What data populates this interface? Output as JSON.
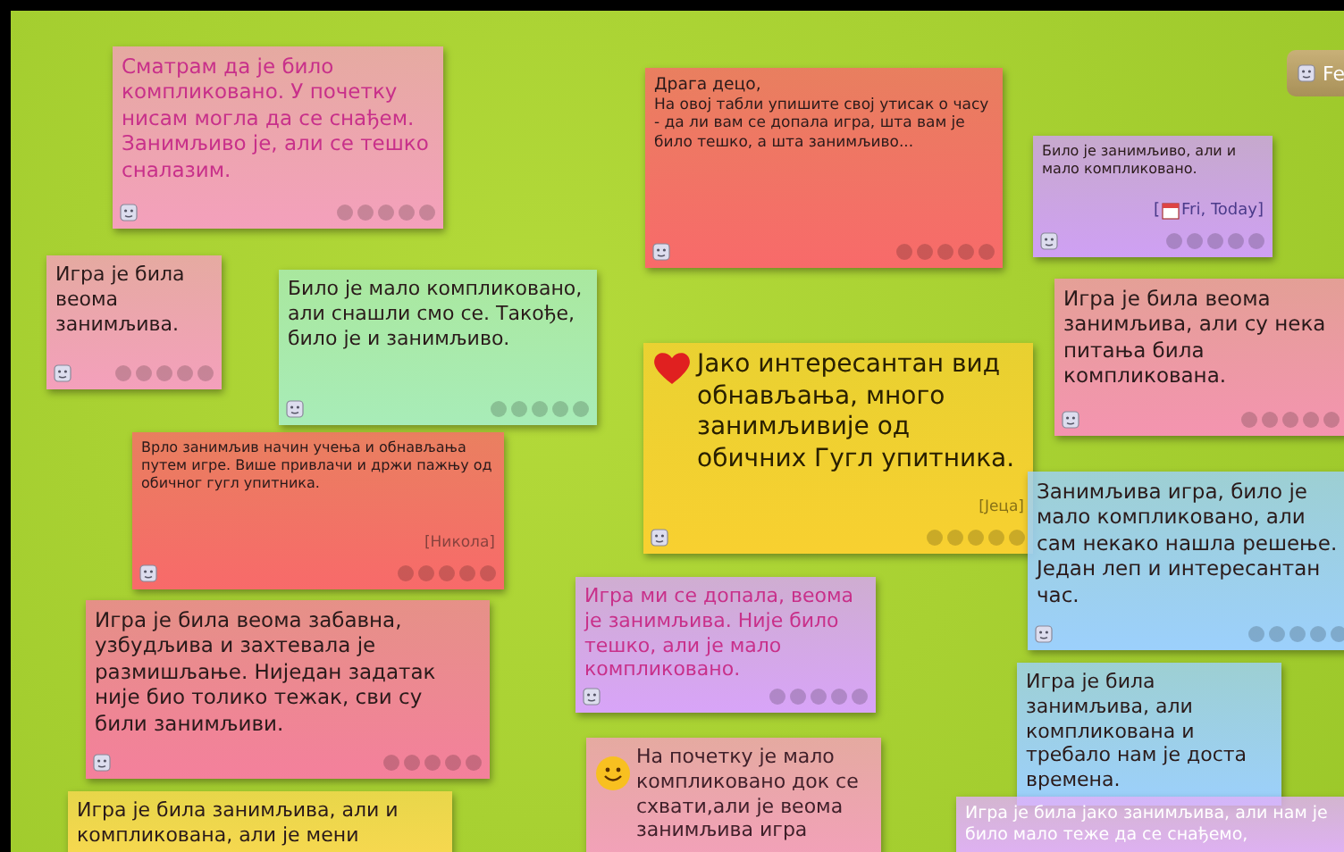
{
  "board_button": {
    "label": "Fe"
  },
  "notes": [
    {
      "kind": "accent",
      "color": "#f4a0bc",
      "text": "Сматрам да је било компликовано. У почетку нисам могла да се снађем. Занимљиво је, али се тешко сналазим.",
      "footer": true
    },
    {
      "kind": "plain",
      "color": "#f86a6a",
      "title": "Драга децо,",
      "text": "На овој табли упишите свој утисак о часу - да ли вам се допала игра, шта вам је било тешко, а шта занимљиво...",
      "footer": true
    },
    {
      "kind": "plain",
      "color": "#cfa0f4",
      "text": "Било је занимљиво, али и мало компликовано.",
      "date_prefix": "[",
      "date": "Fri, Today]",
      "footer": true
    },
    {
      "kind": "plain",
      "color": "#f4a0bc",
      "text": "Игра је била веома занимљива.",
      "footer": true
    },
    {
      "kind": "plain",
      "color": "#a8ecb8",
      "text": "Било је мало компликовано, али снашли смо се. Такође, било је и занимљиво.",
      "footer": true
    },
    {
      "kind": "plain",
      "color": "#f494b0",
      "text": "Игра је била веома занимљива, али су нека питања била компликована.",
      "footer": true
    },
    {
      "kind": "heart",
      "color": "#f8d030",
      "text": "Јако интересантан вид обнављања, много занимљивије од обичних Гугл упитника.",
      "signature": "[Јеца]",
      "footer": true
    },
    {
      "kind": "plain",
      "color": "#f86a6a",
      "text": "Врло занимљив начин учења и обнављања путем игре. Више привлачи и држи пажњу од обичног гугл упитника.",
      "signature": "[Никола]",
      "footer": true
    },
    {
      "kind": "plain",
      "color": "#f4809c",
      "text": "Игра је била веома забавна, узбудљива и захтевала је размишљање. Ниједан задатак није био толико тежак, сви су били занимљиви.",
      "footer": true
    },
    {
      "kind": "accent",
      "color": "#d8a4f8",
      "text": "Игра ми се допала, веома је занимљива. Није било тешко, али је мало компликовано.",
      "footer": true
    },
    {
      "kind": "plain",
      "color": "#9cd0fc",
      "text": "Занимљива игра, било је мало компликовано, али сам некако нашла решење. Један леп и интересантан час.",
      "footer": true
    },
    {
      "kind": "plain",
      "color": "#9cd0fc",
      "text": "Игра је била занимљива, али компликована и требало нам је доста времена.",
      "footer": false
    },
    {
      "kind": "plain",
      "color": "#f8d850",
      "text": "Игра је била занимљива, али и компликована, али је мени",
      "footer": false
    },
    {
      "kind": "smiley",
      "color": "#f4a0bc",
      "text": "На почетку је мало компликовано док се схвати,али је веома занимљива игра",
      "footer": false
    },
    {
      "kind": "inverse",
      "color": "#e0b0f8",
      "text": "Игра је била јако занимљива, али нам је било мало теже да се снађемо,",
      "footer": false
    }
  ]
}
